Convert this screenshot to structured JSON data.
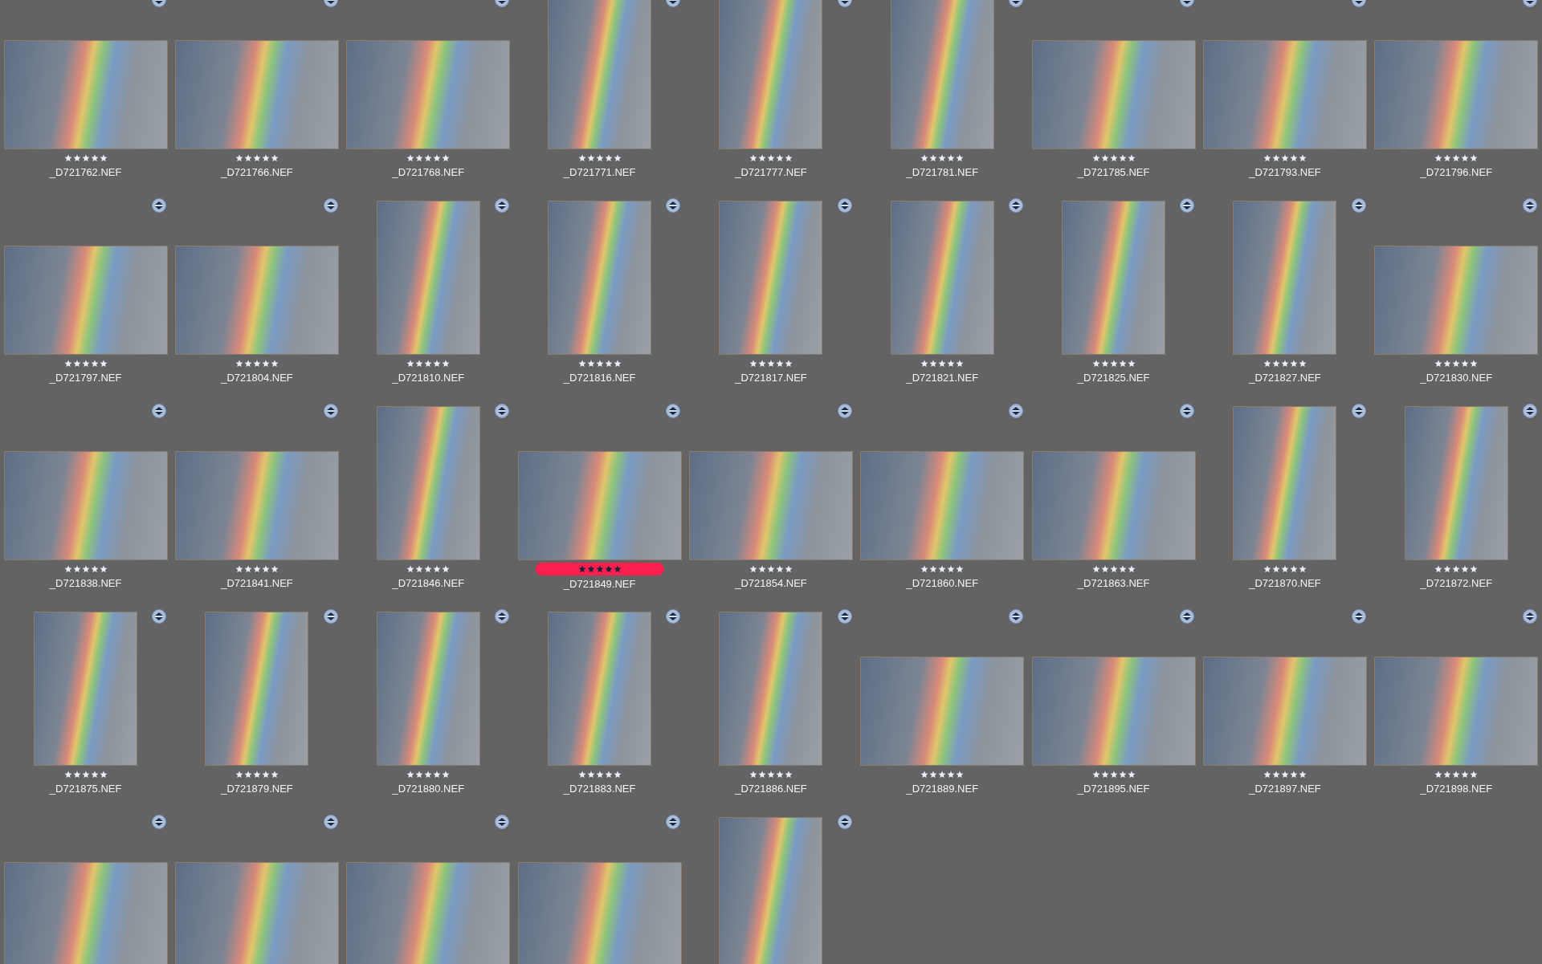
{
  "photos": [
    {
      "kind": "landscape",
      "stars": 5,
      "name": "_D721762.NEF"
    },
    {
      "kind": "landscape",
      "stars": 5,
      "name": "_D721766.NEF"
    },
    {
      "kind": "landscape",
      "stars": 5,
      "name": "_D721768.NEF"
    },
    {
      "kind": "portrait",
      "stars": 5,
      "name": "_D721771.NEF"
    },
    {
      "kind": "portrait",
      "stars": 5,
      "name": "_D721777.NEF"
    },
    {
      "kind": "portrait",
      "stars": 5,
      "name": "_D721781.NEF"
    },
    {
      "kind": "landscape",
      "stars": 5,
      "name": "_D721785.NEF"
    },
    {
      "kind": "landscape",
      "stars": 5,
      "name": "_D721793.NEF"
    },
    {
      "kind": "landscape",
      "stars": 5,
      "name": "_D721796.NEF"
    },
    {
      "kind": "landscape",
      "stars": 5,
      "name": "_D721797.NEF"
    },
    {
      "kind": "landscape",
      "stars": 5,
      "name": "_D721804.NEF"
    },
    {
      "kind": "portrait",
      "stars": 5,
      "name": "_D721810.NEF"
    },
    {
      "kind": "portrait",
      "stars": 5,
      "name": "_D721816.NEF"
    },
    {
      "kind": "portrait",
      "stars": 5,
      "name": "_D721817.NEF"
    },
    {
      "kind": "portrait",
      "stars": 5,
      "name": "_D721821.NEF"
    },
    {
      "kind": "portrait",
      "stars": 5,
      "name": "_D721825.NEF"
    },
    {
      "kind": "portrait",
      "stars": 5,
      "name": "_D721827.NEF"
    },
    {
      "kind": "landscape",
      "stars": 5,
      "name": "_D721830.NEF"
    },
    {
      "kind": "landscape",
      "stars": 5,
      "name": "_D721838.NEF"
    },
    {
      "kind": "landscape",
      "stars": 5,
      "name": "_D721841.NEF"
    },
    {
      "kind": "portrait",
      "stars": 5,
      "name": "_D721846.NEF"
    },
    {
      "kind": "landscape",
      "stars": 5,
      "name": "_D721849.NEF",
      "color": "#fb1f4f"
    },
    {
      "kind": "landscape",
      "stars": 5,
      "name": "_D721854.NEF"
    },
    {
      "kind": "landscape",
      "stars": 5,
      "name": "_D721860.NEF"
    },
    {
      "kind": "landscape",
      "stars": 5,
      "name": "_D721863.NEF"
    },
    {
      "kind": "portrait",
      "stars": 5,
      "name": "_D721870.NEF"
    },
    {
      "kind": "portrait",
      "stars": 5,
      "name": "_D721872.NEF"
    },
    {
      "kind": "portrait",
      "stars": 5,
      "name": "_D721875.NEF"
    },
    {
      "kind": "portrait",
      "stars": 5,
      "name": "_D721879.NEF"
    },
    {
      "kind": "portrait",
      "stars": 5,
      "name": "_D721880.NEF"
    },
    {
      "kind": "portrait",
      "stars": 5,
      "name": "_D721883.NEF"
    },
    {
      "kind": "portrait",
      "stars": 5,
      "name": "_D721886.NEF"
    },
    {
      "kind": "landscape",
      "stars": 5,
      "name": "_D721889.NEF"
    },
    {
      "kind": "landscape",
      "stars": 5,
      "name": "_D721895.NEF"
    },
    {
      "kind": "landscape",
      "stars": 5,
      "name": "_D721897.NEF"
    },
    {
      "kind": "landscape",
      "stars": 5,
      "name": "_D721898.NEF"
    },
    {
      "kind": "landscape"
    },
    {
      "kind": "landscape"
    },
    {
      "kind": "landscape"
    },
    {
      "kind": "landscape"
    },
    {
      "kind": "portrait"
    }
  ]
}
